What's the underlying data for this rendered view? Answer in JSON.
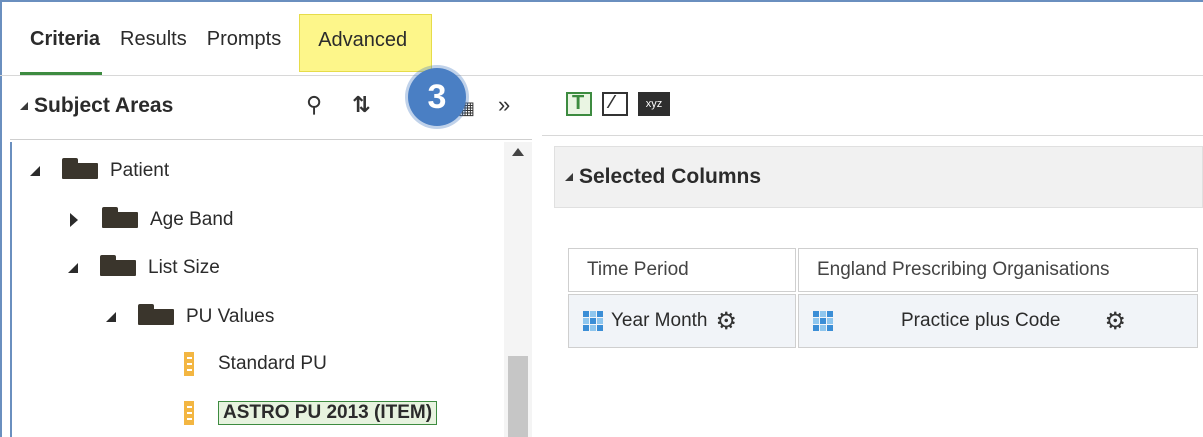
{
  "tabs": [
    {
      "label": "Criteria",
      "active": true
    },
    {
      "label": "Results",
      "active": false
    },
    {
      "label": "Prompts",
      "active": false
    },
    {
      "label": "Advanced",
      "active": false,
      "highlighted": true
    }
  ],
  "step_badge": "3",
  "subject_areas": {
    "title": "Subject Areas",
    "icons": [
      "search-icon",
      "sort-icon",
      "add-subject-area-icon",
      "collapse-panel-icon"
    ]
  },
  "tree": {
    "patient": "Patient",
    "age_band": "Age Band",
    "list_size": "List Size",
    "pu_values": "PU Values",
    "standard_pu": "Standard PU",
    "astro_pu": "ASTRO PU 2013 (ITEM)"
  },
  "toolbar": {
    "icons": [
      "filter-icon",
      "edit-formula-icon",
      "xyz-icon"
    ],
    "xyz_label": "xyz"
  },
  "selected_columns": {
    "title": "Selected Columns",
    "columns": [
      {
        "header": "Time Period",
        "value": "Year Month"
      },
      {
        "header": "England Prescribing Organisations",
        "value": "Practice plus Code"
      }
    ]
  },
  "colors": {
    "accent_green": "#3d8b40",
    "highlight_yellow": "#fdf68a",
    "badge_blue": "#4a7fc4",
    "border_blue": "#6a8fbf"
  }
}
